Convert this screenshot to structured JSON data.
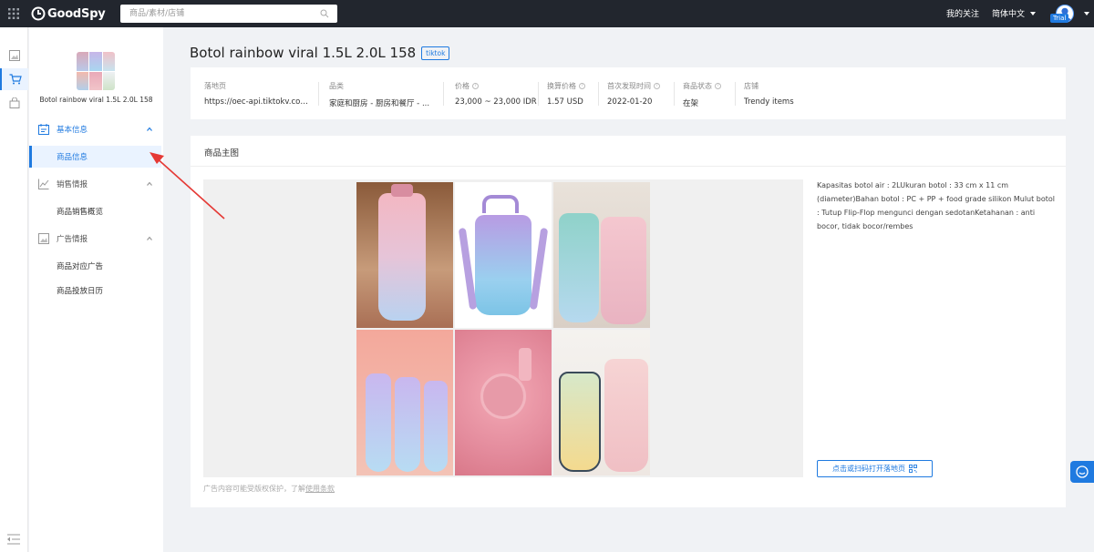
{
  "topbar": {
    "brand": "GoodSpy",
    "search_placeholder": "商品/素材/店铺",
    "follow_label": "我的关注",
    "language_label": "简体中文",
    "trial_badge": "Trial"
  },
  "sidebar": {
    "product_name": "Botol rainbow viral 1.5L 2.0L 158",
    "groups": [
      {
        "label": "基本信息",
        "items": [
          {
            "label": "商品信息"
          }
        ]
      },
      {
        "label": "销售情报",
        "items": [
          {
            "label": "商品销售概览"
          }
        ]
      },
      {
        "label": "广告情报",
        "items": [
          {
            "label": "商品对应广告"
          },
          {
            "label": "商品投放日历"
          }
        ]
      }
    ]
  },
  "header": {
    "title": "Botol rainbow viral 1.5L 2.0L 158",
    "platform_tag": "tiktok"
  },
  "info": {
    "landing_label": "落地页",
    "landing_value": "https://oec-api.tiktokv.com/v...",
    "category_label": "品类",
    "category_value": "家庭和厨房 - 厨房和餐厅 - ...",
    "price_label": "价格",
    "price_value": "23,000 ~ 23,000 IDR",
    "converted_label": "换算价格",
    "converted_value": "1.57 USD",
    "first_seen_label": "首次发现时间",
    "first_seen_value": "2022-01-20",
    "status_label": "商品状态",
    "status_value": "在架",
    "store_label": "店铺",
    "store_value": "Trendy items"
  },
  "main_images": {
    "section_title": "商品主图",
    "description": "Kapasitas botol air : 2LUkuran botol : 33 cm x 11 cm (diameter)Bahan botol : PC + PP + food grade silikon Mulut botol : Tutup Flip-Flop mengunci dengan sedotanKetahanan : anti bocor, tidak bocor/rembes",
    "scan_button": "点击或扫码打开落地页",
    "disclaimer": "广告内容可能受版权保护，了解",
    "disclaimer_link": "使用条款"
  },
  "colors": {
    "accent": "#1f7ae0",
    "topbar_bg": "#22262e",
    "annotation_arrow": "#e53935"
  }
}
